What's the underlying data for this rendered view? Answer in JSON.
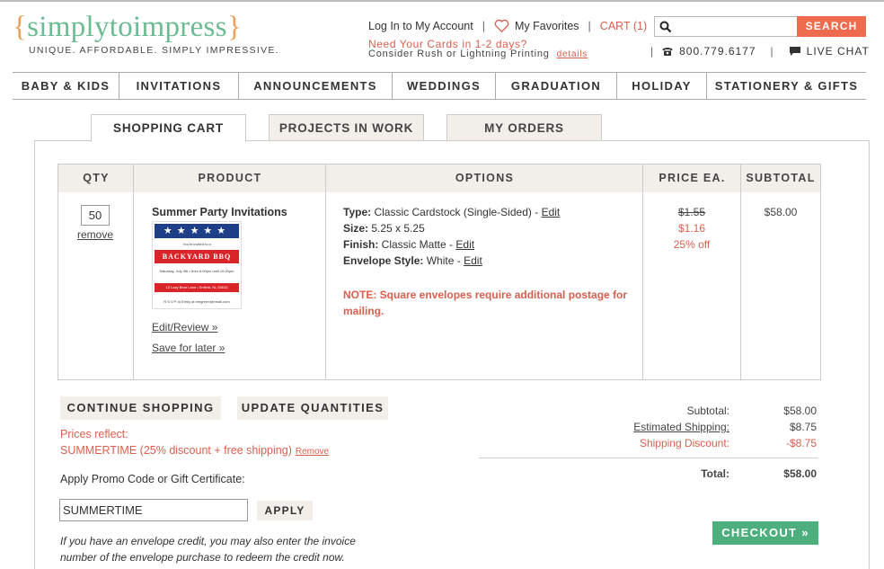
{
  "header": {
    "logo_left_brace": "{",
    "logo_text": "simplytoimpress",
    "logo_right_brace": "}",
    "tagline": "UNIQUE. AFFORDABLE. SIMPLY IMPRESSIVE.",
    "login": "Log In to My Account",
    "favorites": "My Favorites",
    "cart": "CART (1)",
    "sep": "|",
    "rush_headline": "Need Your Cards in 1-2 days?",
    "rush_sub": "Consider Rush or Lightning Printing",
    "details": "details",
    "search_placeholder": "",
    "search_button": "SEARCH",
    "phone": "800.779.6177",
    "live_chat": "LIVE CHAT"
  },
  "nav": [
    "BABY & KIDS",
    "INVITATIONS",
    "ANNOUNCEMENTS",
    "WEDDINGS",
    "GRADUATION",
    "HOLIDAY",
    "STATIONERY & GIFTS"
  ],
  "tabs": [
    "SHOPPING CART",
    "PROJECTS IN WORK",
    "MY ORDERS"
  ],
  "table": {
    "headers": [
      "QTY",
      "PRODUCT",
      "OPTIONS",
      "PRICE EA.",
      "SUBTOTAL"
    ],
    "qty": "50",
    "remove": "remove",
    "product_name": "Summer Party Invitations",
    "card": {
      "stars": "★★★★★",
      "line1": "You're invited to a",
      "title": "BACKYARD BBQ",
      "line2": "Saturday, July 4th • from 6:00pm until 10:00pm",
      "line3": "13 Lazy Bear Lane • Enfield, NL 33610",
      "line4": "R.S.V.P. to Emily at emgreen@email.com"
    },
    "edit_review": "Edit/Review »",
    "save_later": "Save for later »",
    "options": [
      {
        "label": "Type:",
        "value": "Classic Cardstock (Single-Sided)",
        "edit": "Edit"
      },
      {
        "label": "Size:",
        "value": "5.25 x 5.25",
        "edit": ""
      },
      {
        "label": "Finish:",
        "value": "Classic Matte",
        "edit": "Edit"
      },
      {
        "label": "Envelope Style:",
        "value": "White",
        "edit": "Edit"
      }
    ],
    "dash": "-",
    "note": "NOTE: Square envelopes require additional postage for mailing.",
    "price_old": "$1.55",
    "price_new": "$1.16",
    "price_off": "25% off",
    "subtotal": "$58.00"
  },
  "actions": {
    "continue": "CONTINUE SHOPPING",
    "update": "UPDATE QUANTITIES",
    "prices_reflect": "Prices reflect:",
    "promo_applied": "SUMMERTIME (25% discount + free shipping)",
    "promo_remove": "Remove",
    "apply_label": "Apply Promo Code or Gift Certificate:",
    "promo_value": "SUMMERTIME",
    "apply": "APPLY",
    "credit_note": "If you have an envelope credit, you may also enter the invoice number of the envelope purchase to redeem the credit now."
  },
  "totals": {
    "subtotal_label": "Subtotal:",
    "subtotal": "$58.00",
    "shipping_label": "Estimated Shipping:",
    "shipping": "$8.75",
    "discount_label": "Shipping Discount:",
    "discount": "-$8.75",
    "total_label": "Total:",
    "total": "$58.00",
    "checkout": "CHECKOUT »"
  },
  "colors": {
    "brand_green": "#6dbb92",
    "brand_orange": "#e8a25a",
    "accent_red": "#d9604e",
    "search_orange": "#ee6c4d",
    "checkout_green": "#4caf7d",
    "tab_bg": "#f2efea"
  },
  "icons": [
    "heart-icon",
    "search-icon",
    "phone-icon",
    "chat-icon"
  ]
}
